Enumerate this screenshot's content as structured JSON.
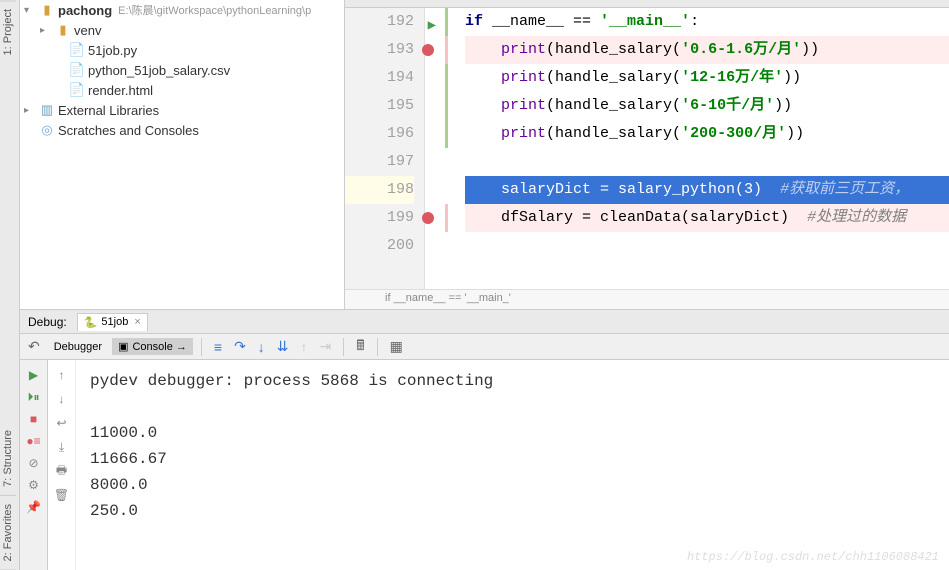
{
  "left_tabs": {
    "project": "1: Project",
    "structure": "7: Structure",
    "favorites": "2: Favorites"
  },
  "tree": {
    "root": {
      "label": "pachong",
      "path": "E:\\陈晨\\gitWorkspace\\pythonLearning\\p"
    },
    "venv": "venv",
    "file_py": "51job.py",
    "file_csv": "python_51job_salary.csv",
    "file_html": "render.html",
    "external": "External Libraries",
    "scratches": "Scratches and Consoles"
  },
  "code": {
    "lines": {
      "192": {
        "num": "192",
        "content_kw": "if",
        "content_rest": " __name__ == ",
        "content_str": "'__main__'",
        "content_tail": ":"
      },
      "193": {
        "num": "193",
        "fn": "print",
        "call": "(handle_salary(",
        "str": "'0.6-1.6万/月'",
        "tail": "))"
      },
      "194": {
        "num": "194",
        "fn": "print",
        "call": "(handle_salary(",
        "str": "'12-16万/年'",
        "tail": "))"
      },
      "195": {
        "num": "195",
        "fn": "print",
        "call": "(handle_salary(",
        "str": "'6-10千/月'",
        "tail": "))"
      },
      "196": {
        "num": "196",
        "fn": "print",
        "call": "(handle_salary(",
        "str": "'200-300/月'",
        "tail": "))"
      },
      "197": {
        "num": "197"
      },
      "198": {
        "num": "198",
        "code": "salaryDict = salary_python(3)  ",
        "comment": "#获取前三页工资，"
      },
      "199": {
        "num": "199",
        "code": "dfSalary = cleanData(salaryDict)  ",
        "comment": "#处理过的数据"
      },
      "200": {
        "num": "200"
      }
    },
    "breadcrumb": "if __name__ == '__main_'"
  },
  "debug": {
    "title": "Debug:",
    "tab_label": "51job",
    "subtabs": {
      "debugger": "Debugger",
      "console": "Console →"
    },
    "output": {
      "connect": "pydev debugger: process 5868 is connecting",
      "v1": "11000.0",
      "v2": "11666.67",
      "v3": "8000.0",
      "v4": "250.0"
    }
  },
  "watermark": "https://blog.csdn.net/chh1106088421"
}
